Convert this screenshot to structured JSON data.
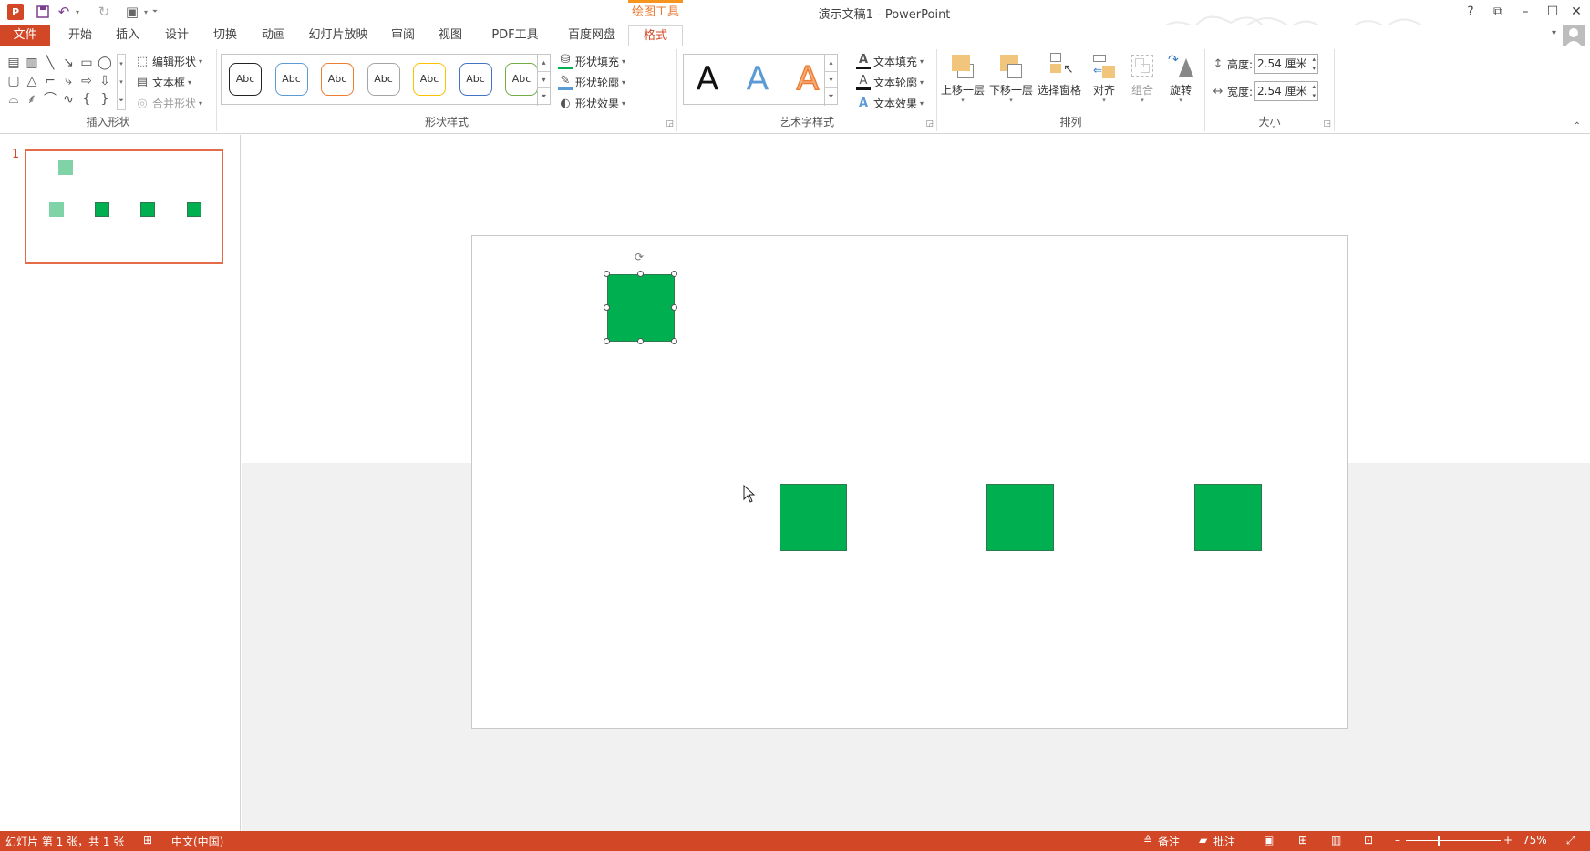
{
  "title_bar": {
    "logo_text": "P",
    "context_group": "绘图工具",
    "window_title": "演示文稿1 - PowerPoint",
    "help": "?",
    "restore_ribbon": "⧉",
    "minimize": "–",
    "maximize": "☐",
    "close": "✕"
  },
  "tabs": {
    "file": "文件",
    "items": [
      "开始",
      "插入",
      "设计",
      "切换",
      "动画",
      "幻灯片放映",
      "审阅",
      "视图",
      "PDF工具集",
      "百度网盘"
    ],
    "active": "格式"
  },
  "ribbon": {
    "insert_shapes": {
      "label": "插入形状",
      "shape_glyphs": [
        "▤",
        "▥",
        "╲",
        "↘",
        "▭",
        "◯",
        "▢",
        "△",
        "⌐",
        "⤷",
        "⇨",
        "⇩",
        "⌓",
        "⸙",
        "⌒",
        "∿",
        "{",
        "}"
      ],
      "edit_shape": "编辑形状",
      "text_box": "文本框",
      "merge_shapes": "合并形状"
    },
    "shape_styles": {
      "label": "形状样式",
      "sample_text": "Abc",
      "style_colors": [
        "#222222",
        "#5b9bd5",
        "#ed7d31",
        "#a5a5a5",
        "#ffc000",
        "#4472c4",
        "#70ad47"
      ],
      "shape_fill": "形状填充",
      "shape_outline": "形状轮廓",
      "shape_effects": "形状效果"
    },
    "wordart_styles": {
      "label": "艺术字样式",
      "letter": "A",
      "text_fill": "文本填充",
      "text_outline": "文本轮廓",
      "text_effects": "文本效果"
    },
    "arrange": {
      "label": "排列",
      "bring_forward": "上移一层",
      "send_backward": "下移一层",
      "selection_pane": "选择窗格",
      "align": "对齐",
      "group": "组合",
      "rotate": "旋转"
    },
    "size": {
      "label": "大小",
      "height_label": "高度:",
      "height_value": "2.54 厘米",
      "width_label": "宽度:",
      "width_value": "2.54 厘米"
    }
  },
  "thumbnail": {
    "number": "1"
  },
  "slide": {
    "shape_color": "#00b050",
    "thumb_light_color": "#7fd3a6"
  },
  "status": {
    "slide_info": "幻灯片 第 1 张，共 1 张",
    "language": "中文(中国)",
    "notes": "备注",
    "comments": "批注",
    "zoom_minus": "–",
    "zoom_plus": "+",
    "zoom": "75%"
  }
}
